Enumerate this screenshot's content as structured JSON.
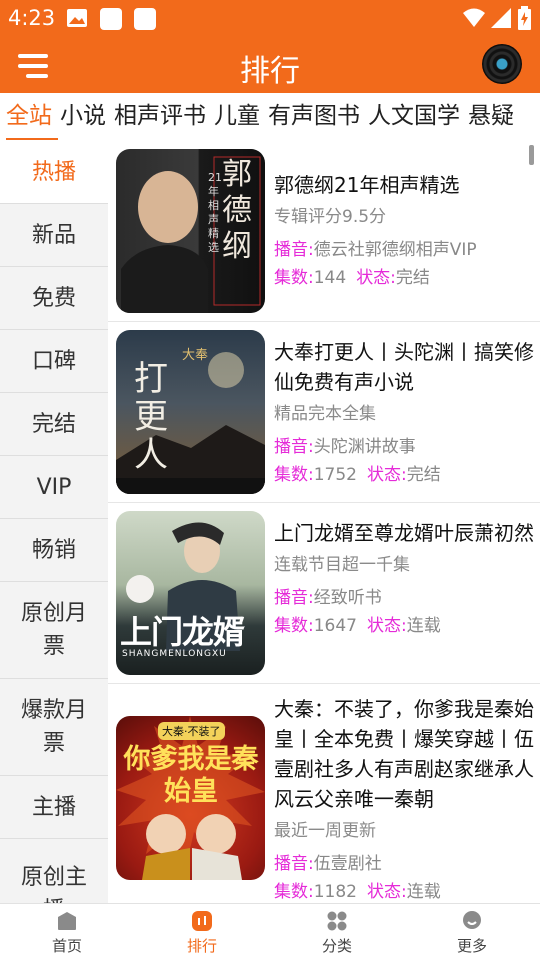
{
  "status": {
    "time": "4:23"
  },
  "header": {
    "title": "排行"
  },
  "tabs": [
    "全站",
    "小说",
    "相声评书",
    "儿童",
    "有声图书",
    "人文国学",
    "悬疑"
  ],
  "sidebar": [
    "热播",
    "新品",
    "免费",
    "口碑",
    "完结",
    "VIP",
    "畅销",
    "原创月票",
    "爆款月票",
    "主播",
    "原创主播"
  ],
  "labels": {
    "host": "播音:",
    "episodes": "集数:",
    "state": "状态:"
  },
  "books": [
    {
      "title": "郭德纲21年相声精选",
      "subtitle": "专辑评分9.5分",
      "host": "德云社郭德纲相声VIP",
      "episodes": "144",
      "state": "完结",
      "cover_text": "郭德纲",
      "cover_sub": "21年相声精选"
    },
    {
      "title": "大奉打更人丨头陀渊丨搞笑修仙免费有声小说",
      "subtitle": "精品完本全集",
      "host": "头陀渊讲故事",
      "episodes": "1752",
      "state": "完结",
      "cover_text": "打更人",
      "cover_sub": "大奉"
    },
    {
      "title": "上门龙婿至尊龙婿叶辰萧初然",
      "subtitle": "连载节目超一千集",
      "host": "经致听书",
      "episodes": "1647",
      "state": "连载",
      "cover_text": "上门龙婿",
      "cover_sub": "SHANGMENLONGXU"
    },
    {
      "title": "大秦：不装了，你爹我是秦始皇丨全本免费丨爆笑穿越丨伍壹剧社多人有声剧赵家继承人风云父亲唯一秦朝",
      "subtitle": "最近一周更新",
      "host": "伍壹剧社",
      "episodes": "1182",
      "state": "连载",
      "cover_text": "你爹我是秦始皇",
      "cover_sub": "大秦·不装了"
    }
  ],
  "bottom_nav": [
    "首页",
    "排行",
    "分类",
    "更多"
  ],
  "colors": {
    "accent": "#f26a1b",
    "label": "#e52bd8"
  }
}
